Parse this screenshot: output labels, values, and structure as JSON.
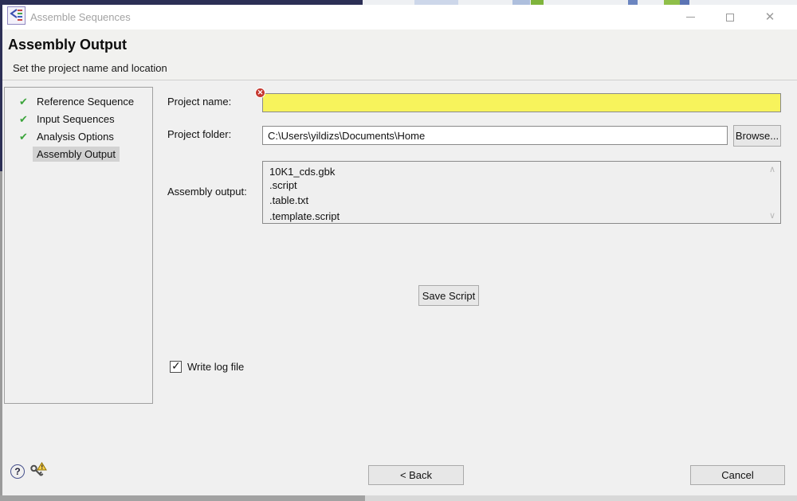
{
  "window": {
    "title": "Assemble Sequences",
    "close_glyph": "✕"
  },
  "header": {
    "title": "Assembly Output",
    "subtitle": "Set the project name and location"
  },
  "wizard_steps": {
    "items": [
      {
        "label": "Reference Sequence",
        "completed": true,
        "active": false
      },
      {
        "label": "Input Sequences",
        "completed": true,
        "active": false
      },
      {
        "label": "Analysis Options",
        "completed": true,
        "active": false
      },
      {
        "label": "Assembly Output",
        "completed": false,
        "active": true
      }
    ],
    "check_glyph": "✔"
  },
  "form": {
    "project_name": {
      "label": "Project name:",
      "value": "",
      "invalid": true,
      "error_glyph": "✕"
    },
    "project_folder": {
      "label": "Project folder:",
      "value": "C:\\Users\\yildizs\\Documents\\Home",
      "browse_label": "Browse..."
    },
    "assembly_output": {
      "label": "Assembly output:",
      "items": [
        "10K1_cds.gbk",
        ".script",
        ".table.txt",
        ".template.script"
      ],
      "scroll_up_glyph": "∧",
      "scroll_down_glyph": "∨"
    },
    "save_script_label": "Save Script",
    "write_log": {
      "label": "Write log file",
      "checked": true,
      "check_glyph": "✓"
    }
  },
  "footer": {
    "help_glyph": "?",
    "back_label": "< Back",
    "cancel_label": "Cancel"
  },
  "colors": {
    "invalid_field_bg": "#f7f35c",
    "step_check_green": "#3ba43b",
    "error_red": "#c63931",
    "warning_yellow": "#ffd24a",
    "background_strip_navy": "#2c2f55",
    "selected_step_bg": "#d2d2d2"
  }
}
